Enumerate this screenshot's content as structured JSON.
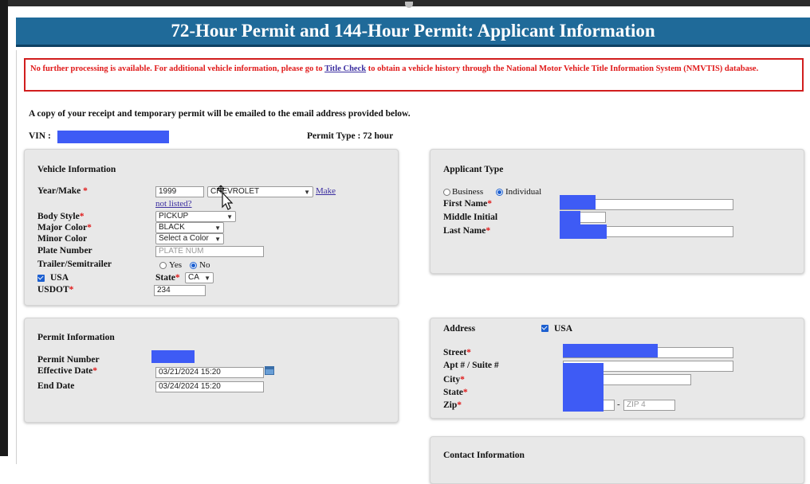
{
  "page": {
    "title": "72-Hour Permit and 144-Hour Permit: Applicant Information",
    "alert": {
      "prefix": "No further processing is available. For additional vehicle information, please go to",
      "link": "Title Check",
      "suffix": "to obtain a vehicle history through the National Motor Vehicle Title Information System (NMVTIS) database."
    },
    "info": "A copy of your receipt and temporary permit will be emailed to the email address provided below.",
    "vin_label": "VIN :",
    "permit_type": "Permit Type : 72 hour"
  },
  "vehicle": {
    "title": "Vehicle Information",
    "year_make_label": "Year/Make",
    "year_value": "1999",
    "make_value": "CHEVROLET",
    "make_link": "Make not listed?",
    "body_style_label": "Body Style",
    "body_style_value": "PICKUP",
    "major_color_label": "Major Color",
    "major_color_value": "BLACK",
    "minor_color_label": "Minor Color",
    "minor_color_value": "Select a Color",
    "plate_label": "Plate Number",
    "plate_placeholder": "PLATE NUM",
    "trailer_label": "Trailer/Semitrailer",
    "yes_label": "Yes",
    "no_label": "No",
    "usa_label": "USA",
    "state_label": "State",
    "state_value": "CA",
    "usdot_label": "USDOT",
    "usdot_value": "234"
  },
  "permit": {
    "title": "Permit Information",
    "number_label": "Permit Number",
    "effective_label": "Effective Date",
    "effective_value": "03/21/2024 15:20",
    "end_label": "End Date",
    "end_value": "03/24/2024 15:20"
  },
  "applicant": {
    "title": "Applicant Type",
    "business_label": "Business",
    "individual_label": "Individual",
    "first_name_label": "First Name",
    "middle_initial_label": "Middle Initial",
    "last_name_label": "Last Name"
  },
  "address": {
    "title": "Address",
    "usa_label": "USA",
    "street_label": "Street",
    "apt_label": "Apt # / Suite #",
    "city_label": "City",
    "state_label": "State",
    "zip_label": "Zip",
    "zip_sep": "-",
    "zip4_placeholder": "ZIP 4"
  },
  "contact": {
    "title": "Contact Information"
  },
  "colors": {
    "banner": "#1f6a99",
    "alert_text": "#e01919",
    "redaction": "#3e5bf5",
    "link": "#3b2ea0"
  }
}
